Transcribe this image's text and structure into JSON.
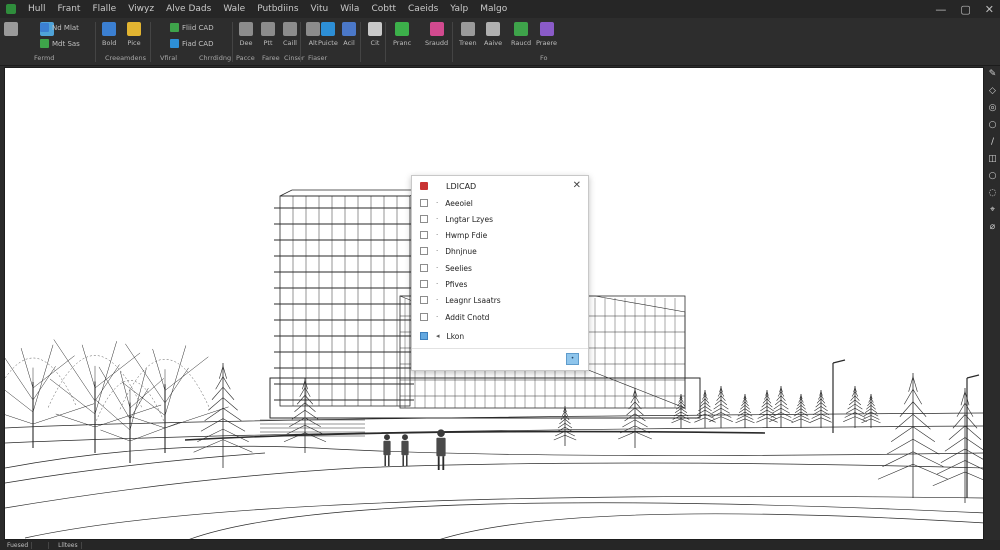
{
  "menu": {
    "items": [
      "Hull",
      "Frant",
      "Flalle",
      "Viwyz",
      "Alve Dads",
      "Wale",
      "Putbdiins",
      "Vitu",
      "Wila",
      "Cobtt",
      "Caeids",
      "Yalp",
      "Malgo"
    ]
  },
  "ribbon": {
    "buttons": [
      {
        "label": "",
        "color": "#9a9a9a"
      },
      {
        "label": "",
        "color": "#4fa3d8"
      },
      {
        "label": "Bold",
        "color": "#3b7fd1"
      },
      {
        "label": "Pice",
        "color": "#e2b431"
      },
      {
        "label": "Dee",
        "color": "#8c8c8c"
      },
      {
        "label": "Ptt",
        "color": "#8c8c8c"
      },
      {
        "label": "Caill",
        "color": "#8c8c8c"
      },
      {
        "label": "Alt",
        "color": "#8c8c8c"
      },
      {
        "label": "Puicte",
        "color": "#2d8fd6"
      },
      {
        "label": "Acil",
        "color": "#4b78c8"
      },
      {
        "label": "Cit",
        "color": "#c9c9c9"
      },
      {
        "label": "Pranc",
        "color": "#3cb04a"
      },
      {
        "label": "Sraudd",
        "color": "#d24a8f"
      },
      {
        "label": "Treen",
        "color": "#9a9a9a"
      },
      {
        "label": "Aaive",
        "color": "#b0b0b0"
      },
      {
        "label": "Raucd",
        "color": "#3ea34a"
      },
      {
        "label": "Praere",
        "color": "#8a5bc8"
      }
    ],
    "small_rows": [
      {
        "label": "Nd Mlat",
        "color": "#3b7fd1"
      },
      {
        "label": "Mdt Sas",
        "color": "#3ea34a"
      },
      {
        "label": "Fliid CAD",
        "color": "#3ea34a"
      },
      {
        "label": "Fiad CAD",
        "color": "#2d8fd6"
      }
    ],
    "panels": [
      "Fermd",
      "Creeamdens",
      "Vfiral",
      "Chrrdidng",
      "Pacce",
      "Faree",
      "Cinser",
      "Fiaser",
      "Fo"
    ]
  },
  "window_controls": {
    "minimize": "—",
    "maximize": "▢",
    "close": "✕"
  },
  "dialog": {
    "title": "LDICAD",
    "close": "✕",
    "items": [
      {
        "label": "Aeeoiel",
        "checked": false
      },
      {
        "label": "Lngtar Lzyes",
        "checked": false
      },
      {
        "label": "Hwmp Fdie",
        "checked": false
      },
      {
        "label": "Dhnjnue",
        "checked": false
      },
      {
        "label": "Seelies",
        "checked": false
      },
      {
        "label": "Pfives",
        "checked": false
      },
      {
        "label": "Leagnr Lsaatrs",
        "checked": false
      },
      {
        "label": "Addit Cnotd",
        "checked": false
      },
      {
        "label": "Lkon",
        "checked": true
      }
    ],
    "ok_glyph": "•"
  },
  "status": {
    "tabs": [
      "Fuesed",
      "",
      "Llltees"
    ]
  },
  "right_tools": [
    "✎",
    "◇",
    "◎",
    "○",
    "/",
    "◫",
    "○",
    "◌",
    "⌖",
    "⌀"
  ]
}
